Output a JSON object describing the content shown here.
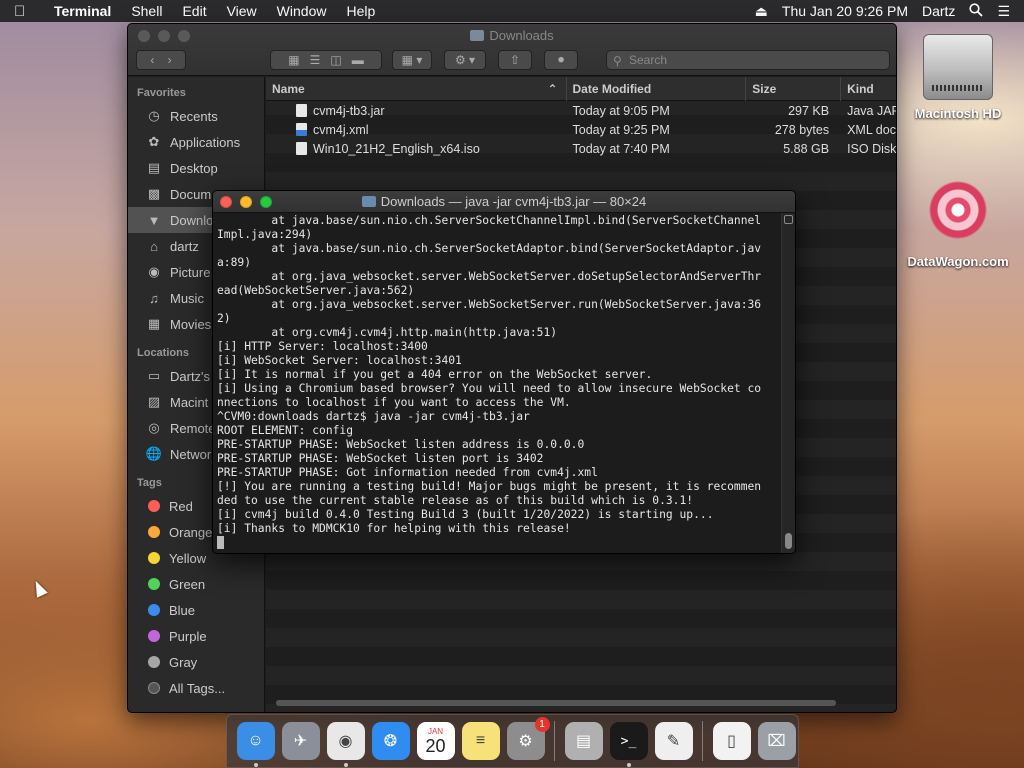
{
  "menubar": {
    "apple_icon": "apple-logo",
    "app_name": "Terminal",
    "items": [
      "Shell",
      "Edit",
      "View",
      "Window",
      "Help"
    ],
    "clock": "Thu Jan 20  9:26 PM",
    "user": "Dartz",
    "icons": [
      "eject-icon",
      "search-icon",
      "list-icon"
    ]
  },
  "desktop": {
    "icons": [
      {
        "label": "Macintosh HD",
        "icon": "hard-drive-icon"
      },
      {
        "label": "DataWagon.com",
        "icon": "datawagon-logo"
      }
    ]
  },
  "finder": {
    "title": "Downloads",
    "search_placeholder": "Search",
    "sidebar": {
      "favorites_heading": "Favorites",
      "favorites": [
        {
          "label": "Recents",
          "icon": "clock-icon"
        },
        {
          "label": "Applications",
          "icon": "applications-icon"
        },
        {
          "label": "Desktop",
          "icon": "desktop-icon"
        },
        {
          "label": "Docum",
          "icon": "document-icon"
        },
        {
          "label": "Downlo",
          "icon": "download-icon",
          "selected": true
        },
        {
          "label": "dartz",
          "icon": "home-icon"
        },
        {
          "label": "Picture",
          "icon": "camera-icon"
        },
        {
          "label": "Music",
          "icon": "music-icon"
        },
        {
          "label": "Movies",
          "icon": "film-icon"
        }
      ],
      "locations_heading": "Locations",
      "locations": [
        {
          "label": "Dartz's",
          "icon": "computer-icon"
        },
        {
          "label": "Macint",
          "icon": "disk-icon"
        },
        {
          "label": "Remote",
          "icon": "disc-icon"
        },
        {
          "label": "Networ",
          "icon": "network-icon"
        }
      ],
      "tags_heading": "Tags",
      "tags": [
        {
          "label": "Red",
          "color": "#ff5c58"
        },
        {
          "label": "Orange",
          "color": "#ffa73a"
        },
        {
          "label": "Yellow",
          "color": "#f5d533"
        },
        {
          "label": "Green",
          "color": "#4fd35a"
        },
        {
          "label": "Blue",
          "color": "#3b8cf2"
        },
        {
          "label": "Purple",
          "color": "#c465e0"
        },
        {
          "label": "Gray",
          "color": "#a6a6a6"
        },
        {
          "label": "All Tags...",
          "color": "#555555"
        }
      ]
    },
    "columns": [
      "Name",
      "Date Modified",
      "Size",
      "Kind"
    ],
    "files": [
      {
        "name": "cvm4j-tb3.jar",
        "date": "Today at 9:05 PM",
        "size": "297 KB",
        "kind": "Java JAR",
        "icon": "jar-file-icon"
      },
      {
        "name": "cvm4j.xml",
        "date": "Today at 9:25 PM",
        "size": "278 bytes",
        "kind": "XML doc",
        "icon": "xml-file-icon"
      },
      {
        "name": "Win10_21H2_English_x64.iso",
        "date": "Today at 7:40 PM",
        "size": "5.88 GB",
        "kind": "ISO Disk",
        "icon": "iso-file-icon"
      }
    ]
  },
  "terminal": {
    "title": "Downloads — java -jar cvm4j-tb3.jar — 80×24",
    "lines": [
      "        at java.base/sun.nio.ch.ServerSocketChannelImpl.bind(ServerSocketChannel",
      "Impl.java:294)",
      "        at java.base/sun.nio.ch.ServerSocketAdaptor.bind(ServerSocketAdaptor.jav",
      "a:89)",
      "        at org.java_websocket.server.WebSocketServer.doSetupSelectorAndServerThr",
      "ead(WebSocketServer.java:562)",
      "        at org.java_websocket.server.WebSocketServer.run(WebSocketServer.java:36",
      "2)",
      "        at org.cvm4j.cvm4j.http.main(http.java:51)",
      "[i] HTTP Server: localhost:3400",
      "[i] WebSocket Server: localhost:3401",
      "[i] It is normal if you get a 404 error on the WebSocket server.",
      "[i] Using a Chromium based browser? You will need to allow insecure WebSocket co",
      "nnections to localhost if you want to access the VM.",
      "^CVM0:downloads dartz$ java -jar cvm4j-tb3.jar",
      "ROOT ELEMENT: config",
      "PRE-STARTUP PHASE: WebSocket listen address is 0.0.0.0",
      "PRE-STARTUP PHASE: WebSocket listen port is 3402",
      "PRE-STARTUP PHASE: Got information needed from cvm4j.xml",
      "[!] You are running a testing build! Major bugs might be present, it is recommen",
      "ded to use the current stable release as of this build which is 0.3.1!",
      "[i] cvm4j build 0.4.0 Testing Build 3 (built 1/20/2022) is starting up...",
      "[i] Thanks to MDMCK10 for helping with this release!"
    ]
  },
  "dock": {
    "apps": [
      {
        "name": "Finder",
        "icon": "finder-icon",
        "color": "#3a8ee6",
        "running": true
      },
      {
        "name": "Launchpad",
        "icon": "rocket-icon",
        "color": "#8a8f99",
        "running": false
      },
      {
        "name": "Google Chrome",
        "icon": "chrome-icon",
        "color": "#e8e8e8",
        "running": true
      },
      {
        "name": "Safari",
        "icon": "compass-icon",
        "color": "#2f8df2",
        "running": false
      },
      {
        "name": "Calendar",
        "icon": "calendar-icon",
        "color": "#ffffff",
        "label": "20",
        "month": "JAN",
        "running": false
      },
      {
        "name": "Notes",
        "icon": "notes-icon",
        "color": "#f7e27a",
        "running": false
      },
      {
        "name": "System Preferences",
        "icon": "gear-icon",
        "color": "#8d8d8d",
        "badge": "1",
        "running": false
      },
      {
        "name": "Archive Utility",
        "icon": "archive-icon",
        "color": "#b0b0b0",
        "running": false
      },
      {
        "name": "Terminal",
        "icon": "terminal-icon",
        "color": "#1a1a1a",
        "running": true
      },
      {
        "name": "TextEdit",
        "icon": "textedit-icon",
        "color": "#efefef",
        "running": false
      },
      {
        "name": "XML File",
        "icon": "file-icon",
        "color": "#f2f2f2",
        "running": false
      },
      {
        "name": "Trash",
        "icon": "trash-icon",
        "color": "#9aa0a6",
        "running": false
      }
    ]
  }
}
